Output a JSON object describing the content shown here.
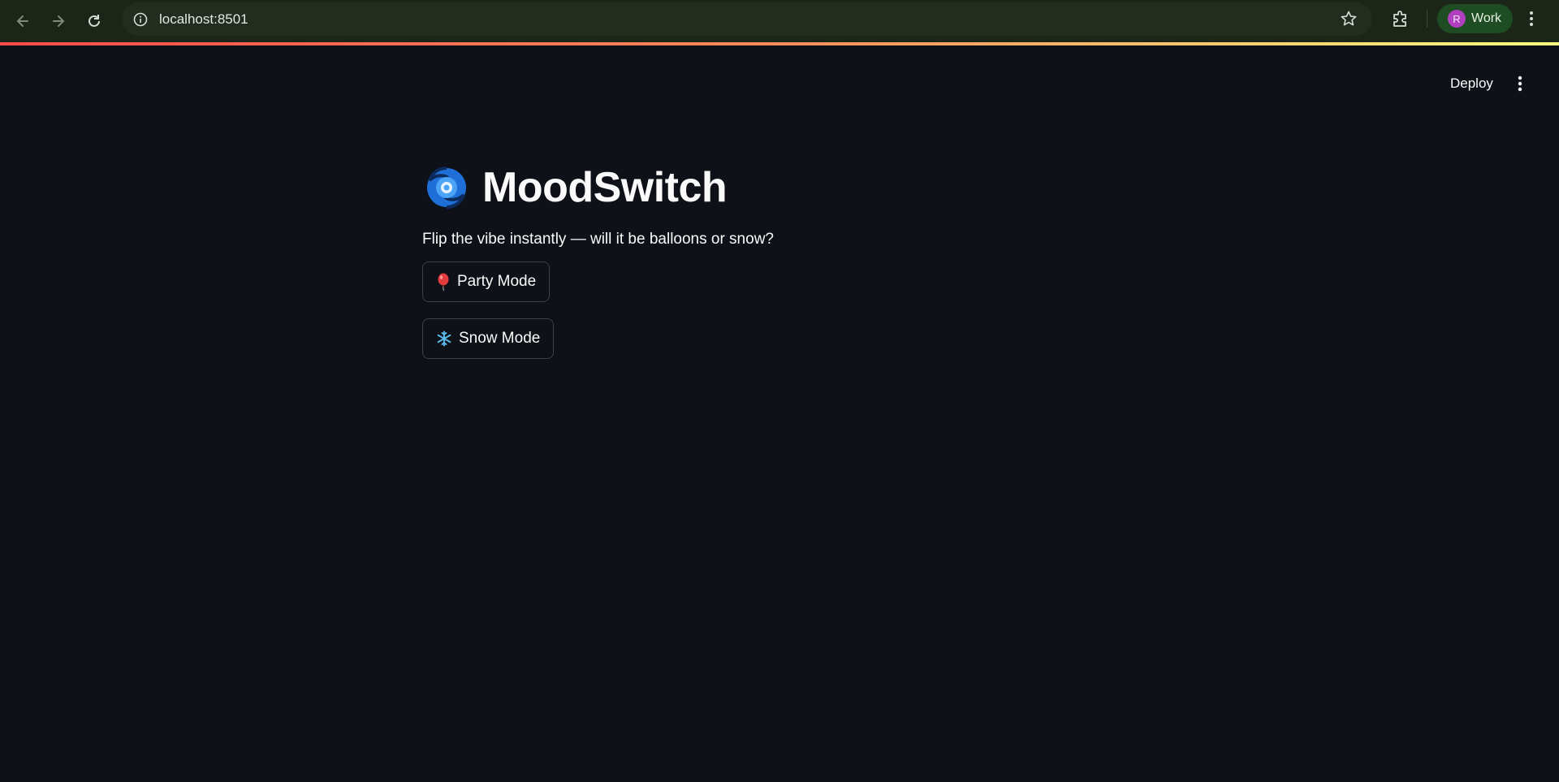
{
  "browser": {
    "url": "localhost:8501",
    "profile_initial": "R",
    "profile_label": "Work"
  },
  "app_header": {
    "deploy_label": "Deploy"
  },
  "main": {
    "title": "MoodSwitch",
    "title_icon": "cyclone-icon",
    "subtitle": "Flip the vibe instantly — will it be balloons or snow?",
    "buttons": [
      {
        "label": "Party Mode",
        "icon": "balloon-icon"
      },
      {
        "label": "Snow Mode",
        "icon": "snowflake-icon"
      }
    ]
  },
  "colors": {
    "background": "#0e1117",
    "browser_bar": "#1b2618",
    "accent_gradient": [
      "#ff4b4b",
      "#fffd80"
    ],
    "button_border": "#3d4048"
  }
}
